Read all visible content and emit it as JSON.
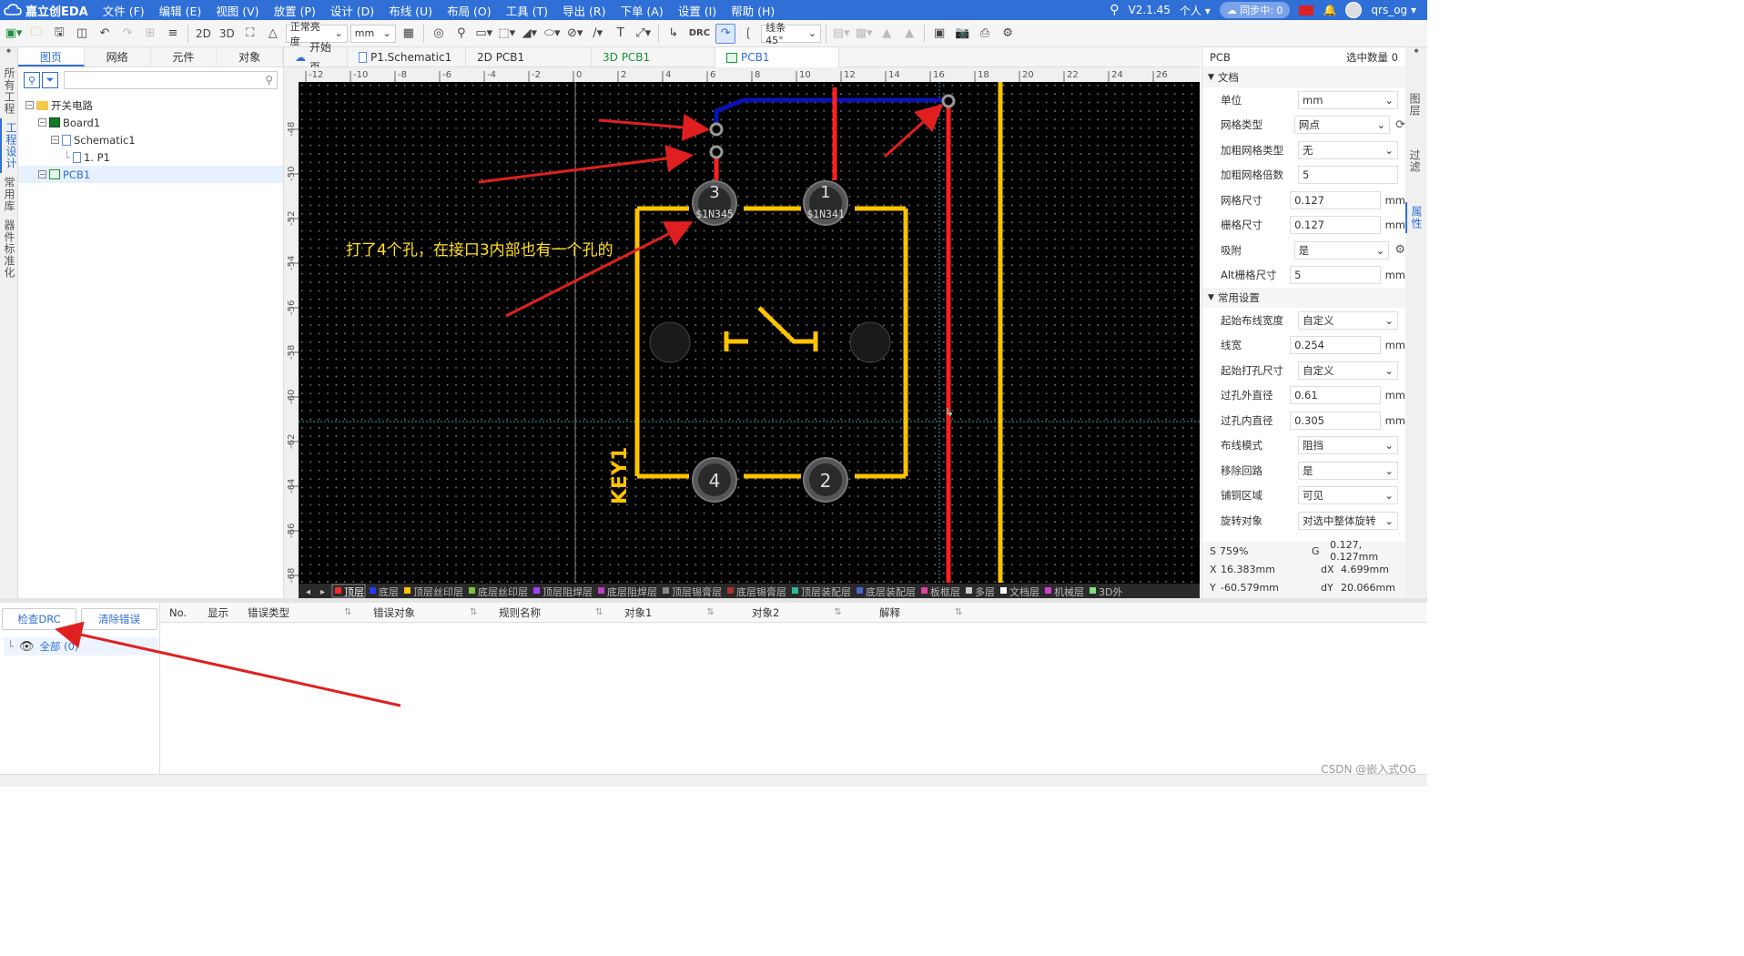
{
  "app": {
    "name": "嘉立创EDA",
    "version": "V2.1.45",
    "user_scope": "个人",
    "sync_label": "同步中: 0",
    "username": "qrs_og"
  },
  "menu": [
    "文件 (F)",
    "编辑 (E)",
    "视图 (V)",
    "放置 (P)",
    "设计 (D)",
    "布线 (U)",
    "布局 (O)",
    "工具 (T)",
    "导出 (R)",
    "下单 (A)",
    "设置 (I)",
    "帮助 (H)"
  ],
  "toolbar": {
    "view_2d": "2D",
    "view_3d": "3D",
    "brightness": "正常亮度",
    "unit": "mm",
    "drc": "DRC",
    "routing_angle": "线条45°"
  },
  "left_vtabs": [
    "所有工程",
    "工程设计",
    "常用库",
    "器件标准化"
  ],
  "left_panel": {
    "tabs": [
      "图页",
      "网络",
      "元件",
      "对象"
    ],
    "tree": [
      {
        "label": "开关电路",
        "depth": 0,
        "icon": "folder-icon"
      },
      {
        "label": "Board1",
        "depth": 1,
        "icon": "board-icon"
      },
      {
        "label": "Schematic1",
        "depth": 2,
        "icon": "schematic-icon"
      },
      {
        "label": "1. P1",
        "depth": 3,
        "icon": "page-icon"
      },
      {
        "label": "PCB1",
        "depth": 1,
        "icon": "pcb-icon",
        "selected": true
      }
    ]
  },
  "doc_tabs": [
    {
      "label": "开始页",
      "icon": "home-icon"
    },
    {
      "label": "P1.Schematic1",
      "icon": "page-icon"
    },
    {
      "label": "2D PCB1",
      "icon": ""
    },
    {
      "label": "3D PCB1",
      "icon": "",
      "prefix_color": "#1f8f3a"
    },
    {
      "label": "PCB1",
      "icon": "pcb-icon",
      "active": true
    }
  ],
  "canvas": {
    "ruler_top": [
      "-12",
      "-10",
      "-8",
      "-6",
      "-4",
      "-2",
      "0",
      "2",
      "4",
      "6",
      "8",
      "10",
      "12",
      "14",
      "16",
      "18",
      "20",
      "22",
      "24",
      "26"
    ],
    "ruler_left": [
      "-48",
      "-50",
      "-52",
      "-54",
      "-56",
      "-58",
      "-60",
      "-62",
      "-64",
      "-66",
      "-68"
    ],
    "annotation": "打了4个孔，在接口3内部也有一个孔的",
    "pads": [
      {
        "num": "3",
        "net": "$1N345"
      },
      {
        "num": "1",
        "net": "$1N341"
      },
      {
        "num": "4",
        "net": ""
      },
      {
        "num": "2",
        "net": ""
      }
    ],
    "designator": "KEY1",
    "layers": [
      "顶层",
      "底层",
      "顶层丝印层",
      "底层丝印层",
      "顶层阻焊层",
      "底层阻焊层",
      "顶层锡膏层",
      "底层锡膏层",
      "顶层装配层",
      "底层装配层",
      "板框层",
      "多层",
      "文档层",
      "机械层",
      "3D外"
    ],
    "layer_colors": [
      "#ff2b2b",
      "#1f3cff",
      "#ffc400",
      "#7fbf3f",
      "#a040ff",
      "#c040c0",
      "#888888",
      "#aa3333",
      "#2fb89a",
      "#4466cc",
      "#e040a0",
      "#cccccc",
      "#ffffff",
      "#d040d0",
      "#7fdf7f"
    ]
  },
  "right_panel": {
    "title": "PCB",
    "selected_count": "选中数量 0",
    "doc_section": "文档",
    "doc_rows": [
      {
        "label": "单位",
        "value": "mm",
        "dropdown": true,
        "unit": ""
      },
      {
        "label": "网格类型",
        "value": "网点",
        "dropdown": true,
        "unit": ""
      },
      {
        "label": "加粗网格类型",
        "value": "无",
        "dropdown": true,
        "unit": ""
      },
      {
        "label": "加粗网格倍数",
        "value": "5",
        "dropdown": false,
        "unit": ""
      },
      {
        "label": "网格尺寸",
        "value": "0.127",
        "dropdown": false,
        "unit": "mm"
      },
      {
        "label": "栅格尺寸",
        "value": "0.127",
        "dropdown": false,
        "unit": "mm"
      },
      {
        "label": "吸附",
        "value": "是",
        "dropdown": true,
        "unit": ""
      },
      {
        "label": "Alt栅格尺寸",
        "value": "5",
        "dropdown": false,
        "unit": "mm"
      }
    ],
    "common_section": "常用设置",
    "common_rows": [
      {
        "label": "起始布线宽度",
        "value": "自定义",
        "dropdown": true,
        "unit": ""
      },
      {
        "label": "线宽",
        "value": "0.254",
        "dropdown": false,
        "unit": "mm"
      },
      {
        "label": "起始打孔尺寸",
        "value": "自定义",
        "dropdown": true,
        "unit": ""
      },
      {
        "label": "过孔外直径",
        "value": "0.61",
        "dropdown": false,
        "unit": "mm"
      },
      {
        "label": "过孔内直径",
        "value": "0.305",
        "dropdown": false,
        "unit": "mm"
      },
      {
        "label": "布线模式",
        "value": "阻挡",
        "dropdown": true,
        "unit": ""
      },
      {
        "label": "移除回路",
        "value": "是",
        "dropdown": true,
        "unit": ""
      },
      {
        "label": "铺铜区域",
        "value": "可见",
        "dropdown": true,
        "unit": ""
      },
      {
        "label": "旋转对象",
        "value": "对选中整体旋转",
        "dropdown": true,
        "unit": ""
      }
    ],
    "status": {
      "S": "759%",
      "G": "0.127, 0.127mm",
      "X": "16.383mm",
      "dX": "4.699mm",
      "Y": "-60.579mm",
      "dY": "20.066mm"
    }
  },
  "right_vtabs": [
    "图层",
    "过滤",
    "属性"
  ],
  "bottom": {
    "check_drc": "检查DRC",
    "clear_errors": "清除错误",
    "all_label": "全部 (0)",
    "columns": [
      "No.",
      "显示",
      "错误类型",
      "错误对象",
      "规则名称",
      "对象1",
      "对象2",
      "解释"
    ]
  },
  "watermark": "CSDN @嵌入式OG"
}
